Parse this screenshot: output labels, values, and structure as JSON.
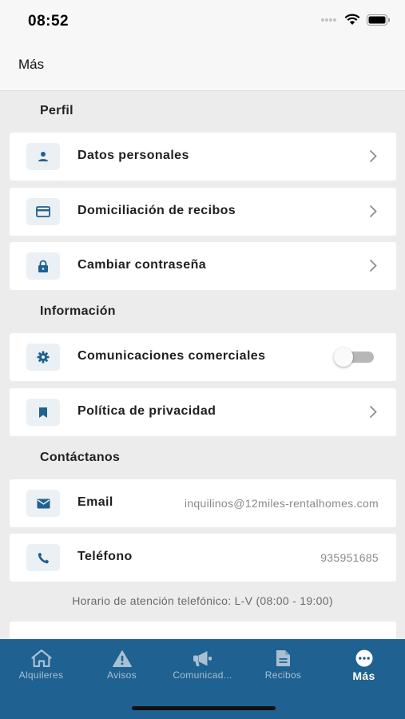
{
  "status_bar": {
    "time": "08:52"
  },
  "header": {
    "title": "Más"
  },
  "sections": {
    "perfil": "Perfil",
    "informacion": "Información",
    "contacto": "Contáctanos"
  },
  "items": {
    "datos_personales": {
      "label": "Datos personales",
      "icon": "person-icon"
    },
    "domiciliacion": {
      "label": "Domiciliación de recibos",
      "icon": "credit-card-icon"
    },
    "contrasena": {
      "label": "Cambiar contraseña",
      "icon": "lock-icon"
    },
    "comunicaciones": {
      "label": "Comunicaciones comerciales",
      "icon": "gear-icon",
      "toggle_on": false
    },
    "privacidad": {
      "label": "Política de privacidad",
      "icon": "bookmark-icon"
    },
    "email": {
      "label": "Email",
      "value": "inquilinos@12miles-rentalhomes.com",
      "icon": "mail-icon"
    },
    "telefono": {
      "label": "Teléfono",
      "value": "935951685",
      "icon": "phone-icon"
    }
  },
  "hours_note": "Horario de atención telefónico: L-V (08:00 - 19:00)",
  "tabs": [
    {
      "label": "Alquileres",
      "icon": "home-icon"
    },
    {
      "label": "Avisos",
      "icon": "warning-icon"
    },
    {
      "label": "Comunicad...",
      "icon": "megaphone-icon"
    },
    {
      "label": "Recibos",
      "icon": "document-icon"
    },
    {
      "label": "Más",
      "icon": "more-icon",
      "active": true
    }
  ],
  "colors": {
    "accent": "#1f6190",
    "tab_inactive": "#a9c0d3",
    "icon_bg": "#ebf0f4",
    "background": "#ececec"
  }
}
